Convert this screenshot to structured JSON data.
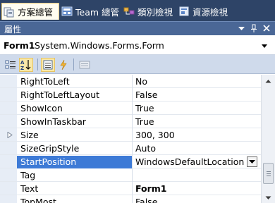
{
  "tabs": [
    {
      "label": "方案總管",
      "icon": "solution-explorer-icon",
      "active": true
    },
    {
      "label": "Team 總管",
      "icon": "team-explorer-icon",
      "active": false
    },
    {
      "label": "類別檢視",
      "icon": "class-view-icon",
      "active": false
    },
    {
      "label": "資源檢視",
      "icon": "resource-view-icon",
      "active": false
    }
  ],
  "panel": {
    "title": "屬性",
    "buttons": [
      "▼",
      "ᅲ",
      "×"
    ]
  },
  "object_selector": {
    "name": "Form1",
    "type": "System.Windows.Forms.Form"
  },
  "toolbar": {
    "buttons": [
      "categorized-icon",
      "alphabetical-icon",
      "properties-icon",
      "events-icon",
      "property-pages-icon"
    ],
    "pressed": "alphabetical-icon"
  },
  "properties": [
    {
      "name": "RightToLeft",
      "value": "No"
    },
    {
      "name": "RightToLeftLayout",
      "value": "False"
    },
    {
      "name": "ShowIcon",
      "value": "True"
    },
    {
      "name": "ShowInTaskbar",
      "value": "True"
    },
    {
      "name": "Size",
      "value": "300, 300",
      "expandable": true
    },
    {
      "name": "SizeGripStyle",
      "value": "Auto"
    },
    {
      "name": "StartPosition",
      "value": "WindowsDefaultLocation",
      "selected": true
    },
    {
      "name": "Tag",
      "value": ""
    },
    {
      "name": "Text",
      "value": "Form1",
      "bold": true
    },
    {
      "name": "TopMost",
      "value": "False"
    }
  ],
  "colors": {
    "tab_background": "#2e4467",
    "title_bar": "#4a6796",
    "selection": "#3d7ad6",
    "toolbar": "#cfdaeb"
  }
}
